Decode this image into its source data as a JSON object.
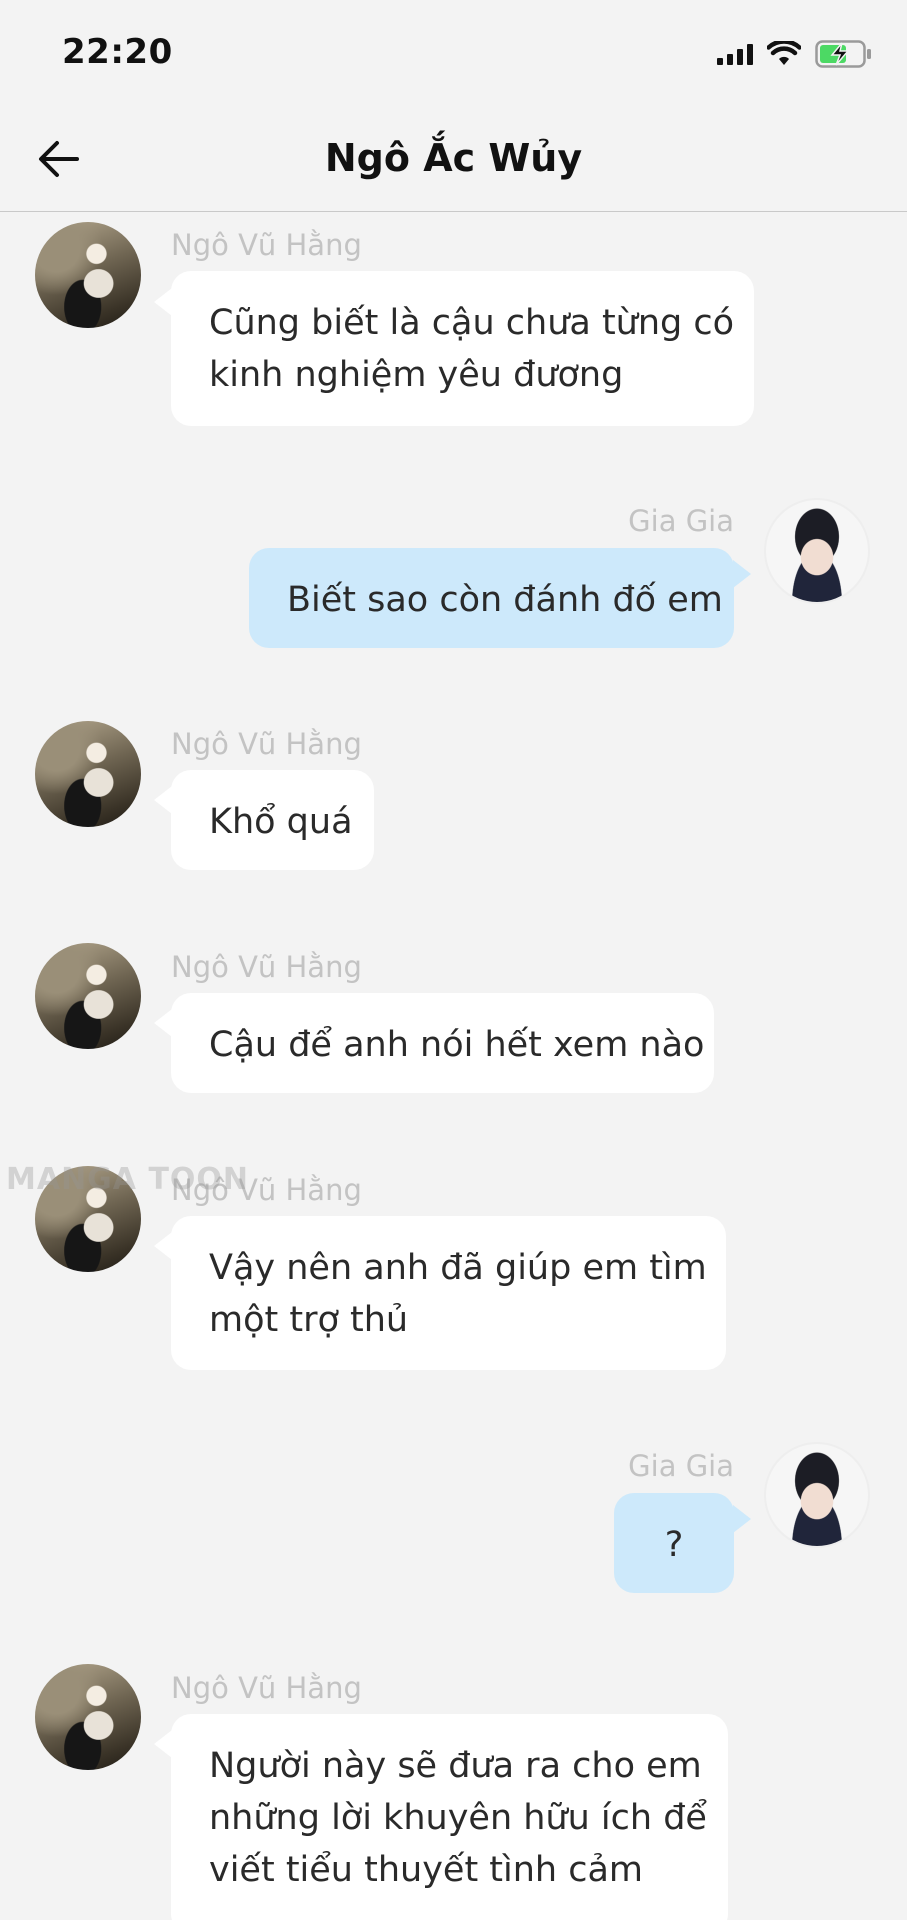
{
  "status_bar": {
    "time": "22:20",
    "icons": [
      "signal-icon",
      "wifi-icon",
      "battery-charging-icon"
    ]
  },
  "header": {
    "title": "Ngô Ắc Wủy",
    "back_icon": "back-arrow-icon"
  },
  "watermark": "MANGA TOON",
  "messages": [
    {
      "side": "left",
      "sender": "Ngô Vũ Hằng",
      "lines": [
        "Cũng biết là cậu chưa từng có",
        "kinh nghiệm yêu đương"
      ]
    },
    {
      "side": "right",
      "sender": "Gia Gia",
      "lines": [
        "Biết sao còn đánh đố em"
      ]
    },
    {
      "side": "left",
      "sender": "Ngô Vũ Hằng",
      "lines": [
        "Khổ quá"
      ]
    },
    {
      "side": "left",
      "sender": "Ngô Vũ Hằng",
      "lines": [
        "Cậu để anh nói hết xem nào"
      ]
    },
    {
      "side": "left",
      "sender": "Ngô Vũ Hằng",
      "lines": [
        "Vậy nên anh đã giúp em tìm",
        "một trợ thủ"
      ]
    },
    {
      "side": "right",
      "sender": "Gia Gia",
      "lines": [
        "?"
      ]
    },
    {
      "side": "left",
      "sender": "Ngô Vũ Hằng",
      "lines": [
        "Người này sẽ đưa ra cho em",
        "những lời khuyên hữu ích để",
        "viết tiểu thuyết tình cảm"
      ]
    }
  ],
  "colors": {
    "background": "#f3f3f3",
    "bubble_left": "#ffffff",
    "bubble_right": "#cde9fb",
    "sender_name": "#c3c3c3",
    "battery_fill": "#4cd964"
  }
}
